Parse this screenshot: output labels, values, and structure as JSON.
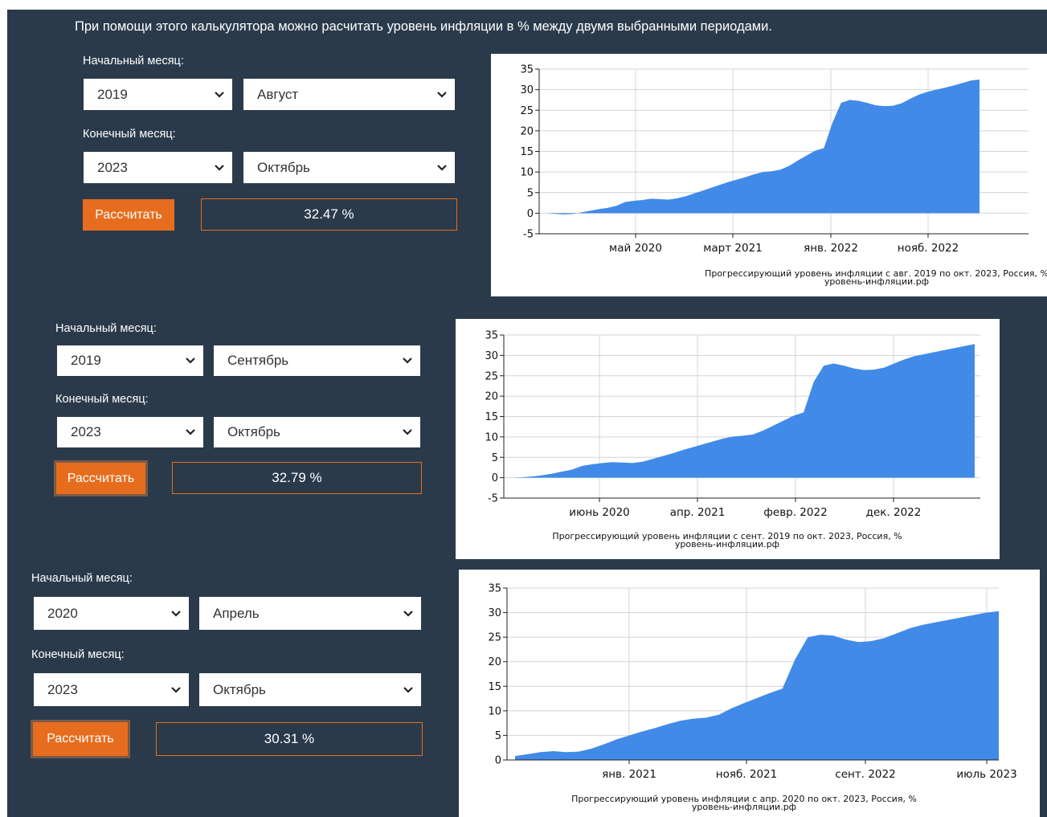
{
  "intro": "При помощи этого калькулятора можно расчитать уровень инфляции в % между двумя выбранными периодами.",
  "colors": {
    "background": "#2b3a4b",
    "accent": "#e66d1e",
    "area": "#428ae8"
  },
  "panels": [
    {
      "start_label": "Начальный месяц:",
      "start_year": "2019",
      "start_month": "Август",
      "end_label": "Конечный месяц:",
      "end_year": "2023",
      "end_month": "Октябрь",
      "button_label": "Рассчитать",
      "result": "32.47 %",
      "chart_data": {
        "type": "area",
        "y_ticks": [
          "35",
          "30",
          "25",
          "20",
          "15",
          "10",
          "5",
          "0",
          "-5"
        ],
        "ylim": [
          -5,
          35
        ],
        "x_ticks": [
          "май 2020",
          "март 2021",
          "янв. 2022",
          "нояб. 2022"
        ],
        "caption_line1": "Прогрессирующий уровень инфляции с авг. 2019 по окт. 2023, Россия, %",
        "caption_line2": "уровень-инфляции.рф",
        "grid": true,
        "values": [
          0.0,
          -0.2,
          -0.3,
          -0.2,
          0.2,
          0.6,
          1.0,
          1.3,
          1.8,
          2.7,
          3.0,
          3.2,
          3.5,
          3.4,
          3.3,
          3.6,
          4.1,
          4.8,
          5.5,
          6.2,
          6.9,
          7.6,
          8.2,
          8.8,
          9.5,
          10.0,
          10.2,
          10.6,
          11.5,
          12.8,
          14.0,
          15.2,
          15.8,
          22.0,
          26.8,
          27.5,
          27.3,
          26.8,
          26.2,
          26.0,
          26.1,
          26.7,
          27.8,
          28.8,
          29.5,
          30.0,
          30.5,
          31.0,
          31.6,
          32.2,
          32.47
        ]
      }
    },
    {
      "start_label": "Начальный месяц:",
      "start_year": "2019",
      "start_month": "Сентябрь",
      "end_label": "Конечный месяц:",
      "end_year": "2023",
      "end_month": "Октябрь",
      "button_label": "Рассчитать",
      "result": "32.79 %",
      "chart_data": {
        "type": "area",
        "y_ticks": [
          "35",
          "30",
          "25",
          "20",
          "15",
          "10",
          "5",
          "0",
          "-5"
        ],
        "ylim": [
          -5,
          35
        ],
        "x_ticks": [
          "июнь 2020",
          "апр. 2021",
          "февр. 2022",
          "дек. 2022"
        ],
        "caption_line1": "Прогрессирующий уровень инфляции с сент. 2019 по окт. 2023, Россия, %",
        "caption_line2": "уровень-инфляции.рф",
        "grid": true,
        "values": [
          0.0,
          0.1,
          0.3,
          0.6,
          1.0,
          1.5,
          2.0,
          2.9,
          3.3,
          3.6,
          3.8,
          3.7,
          3.6,
          3.9,
          4.6,
          5.3,
          6.0,
          6.8,
          7.5,
          8.2,
          8.9,
          9.6,
          10.1,
          10.3,
          10.6,
          11.6,
          12.8,
          14.0,
          15.2,
          16.0,
          23.5,
          27.5,
          28.0,
          27.5,
          26.8,
          26.4,
          26.5,
          27.0,
          28.0,
          29.0,
          29.8,
          30.3,
          30.8,
          31.3,
          31.8,
          32.3,
          32.79
        ]
      }
    },
    {
      "start_label": "Начальный месяц:",
      "start_year": "2020",
      "start_month": "Апрель",
      "end_label": "Конечный месяц:",
      "end_year": "2023",
      "end_month": "Октябрь",
      "button_label": "Рассчитать",
      "result": "30.31 %",
      "chart_data": {
        "type": "area",
        "y_ticks": [
          "35",
          "30",
          "25",
          "20",
          "15",
          "10",
          "5",
          "0"
        ],
        "ylim": [
          0,
          35
        ],
        "x_ticks": [
          "янв. 2021",
          "нояб. 2021",
          "сент. 2022",
          "июль 2023"
        ],
        "caption_line1": "Прогрессирующий уровень инфляции с апр. 2020 по окт. 2023, Россия, %",
        "caption_line2": "уровень-инфляции.рф",
        "grid": true,
        "values": [
          0.8,
          1.2,
          1.6,
          1.8,
          1.6,
          1.7,
          2.3,
          3.2,
          4.2,
          5.0,
          5.8,
          6.5,
          7.3,
          8.0,
          8.4,
          8.6,
          9.2,
          10.5,
          11.6,
          12.6,
          13.6,
          14.5,
          20.5,
          25.0,
          25.5,
          25.3,
          24.5,
          24.0,
          24.2,
          24.8,
          25.8,
          26.8,
          27.5,
          28.0,
          28.5,
          29.0,
          29.5,
          30.0,
          30.31
        ]
      }
    }
  ]
}
